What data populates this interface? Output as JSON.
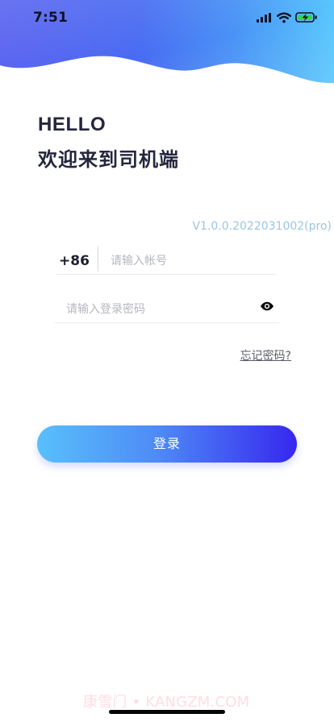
{
  "status_bar": {
    "time": "7:51"
  },
  "greeting": {
    "hello": "HELLO",
    "welcome": "欢迎来到司机端"
  },
  "login_form": {
    "version": "V1.0.0.2022031002(pro)",
    "country_code": "+86",
    "account_placeholder": "请输入帐号",
    "password_placeholder": "请输入登录密码",
    "forgot_password": "忘记密码?",
    "login_button": "登录"
  },
  "watermark": {
    "text": "康雪门 • KANGZM.COM"
  },
  "icons": {
    "signal": "signal-icon",
    "wifi": "wifi-icon",
    "battery": "battery-charging-icon",
    "password_visibility": "eye-icon"
  },
  "colors": {
    "header_gradient_start": "#5660ef",
    "header_gradient_middle": "#4b8ff6",
    "header_gradient_end": "#58c6fc",
    "text_primary": "#25263d",
    "version_text": "#9bc6e1",
    "placeholder": "#b6b7bf",
    "button_gradient_start": "#58c0fb",
    "button_gradient_end": "#3727ef"
  }
}
